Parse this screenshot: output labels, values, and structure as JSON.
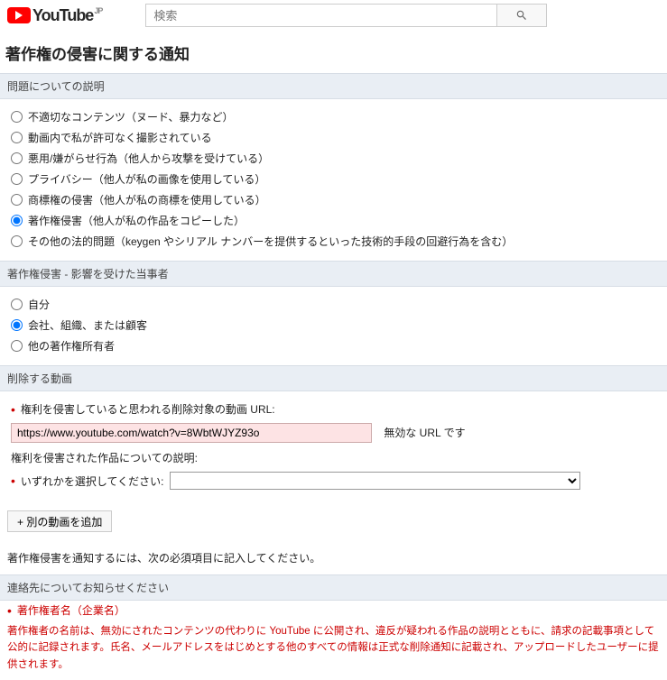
{
  "header": {
    "logo_text": "YouTube",
    "region_suffix": "JP",
    "search_placeholder": "検索"
  },
  "page_title": "著作権の侵害に関する通知",
  "sections": {
    "issue": {
      "heading": "問題についての説明",
      "options": [
        "不適切なコンテンツ（ヌード、暴力など）",
        "動画内で私が許可なく撮影されている",
        "悪用/嫌がらせ行為（他人から攻撃を受けている）",
        "プライバシー（他人が私の画像を使用している）",
        "商標権の侵害（他人が私の商標を使用している）",
        "著作権侵害（他人が私の作品をコピーした）",
        "その他の法的問題（keygen やシリアル ナンバーを提供するといった技術的手段の回避行為を含む）"
      ],
      "selected_index": 5
    },
    "affected": {
      "heading": "著作権侵害 - 影響を受けた当事者",
      "options": [
        "自分",
        "会社、組織、または顧客",
        "他の著作権所有者"
      ],
      "selected_index": 1
    },
    "video": {
      "heading": "削除する動画",
      "url_label": "権利を侵害していると思われる削除対象の動画 URL:",
      "url_value": "https://www.youtube.com/watch?v=8WbtWJYZ93o",
      "url_error": "無効な URL です",
      "desc_label": "権利を侵害された作品についての説明:",
      "select_placeholder": "いずれかを選択してください:",
      "add_button": "+ 別の動画を追加"
    },
    "instruction": "著作権侵害を通知するには、次の必須項目に記入してください。",
    "contact": {
      "heading": "連絡先についてお知らせください",
      "owner_label": "著作権者名（企業名）",
      "warning": "著作権者の名前は、無効にされたコンテンツの代わりに YouTube に公開され、違反が疑われる作品の説明とともに、請求の記載事項として公的に記録されます。氏名、メールアドレスをはじめとする他のすべての情報は正式な削除通知に記載され、アップロードしたユーザーに提供されます。"
    }
  }
}
